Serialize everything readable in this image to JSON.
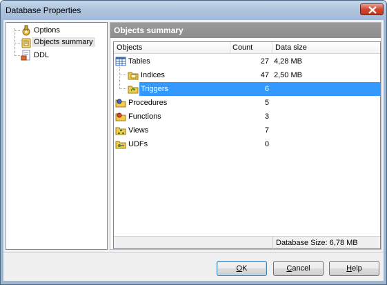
{
  "window": {
    "title": "Database Properties",
    "colors": {
      "titlebar": "#aec3db",
      "selection": "#3399ff",
      "close": "#d0472f",
      "header": "#8c8c8c"
    }
  },
  "tree": {
    "items": [
      {
        "label": "Options",
        "icon": "options-icon"
      },
      {
        "label": "Objects summary",
        "icon": "objects-summary-icon",
        "selected": true
      },
      {
        "label": "DDL",
        "icon": "ddl-icon"
      }
    ]
  },
  "summary": {
    "title": "Objects summary",
    "columns": [
      "Objects",
      "Count",
      "Data size"
    ],
    "rows": [
      {
        "name": "Tables",
        "count": "27",
        "size": "4,28 MB",
        "icon": "tables-icon",
        "level": 0
      },
      {
        "name": "Indices",
        "count": "47",
        "size": "2,50 MB",
        "icon": "indices-icon",
        "level": 1
      },
      {
        "name": "Triggers",
        "count": "6",
        "size": "",
        "icon": "triggers-icon",
        "level": 1,
        "selected": true
      },
      {
        "name": "Procedures",
        "count": "5",
        "size": "",
        "icon": "procedures-icon",
        "level": 0
      },
      {
        "name": "Functions",
        "count": "3",
        "size": "",
        "icon": "functions-icon",
        "level": 0
      },
      {
        "name": "Views",
        "count": "7",
        "size": "",
        "icon": "views-icon",
        "level": 0
      },
      {
        "name": "UDFs",
        "count": "0",
        "size": "",
        "icon": "udfs-icon",
        "level": 0
      }
    ],
    "database_size": "Database Size: 6,78 MB"
  },
  "buttons": {
    "ok": {
      "pre": "",
      "accel": "O",
      "post": "K"
    },
    "cancel": {
      "pre": "",
      "accel": "C",
      "post": "ancel"
    },
    "help": {
      "pre": "",
      "accel": "H",
      "post": "elp"
    }
  }
}
